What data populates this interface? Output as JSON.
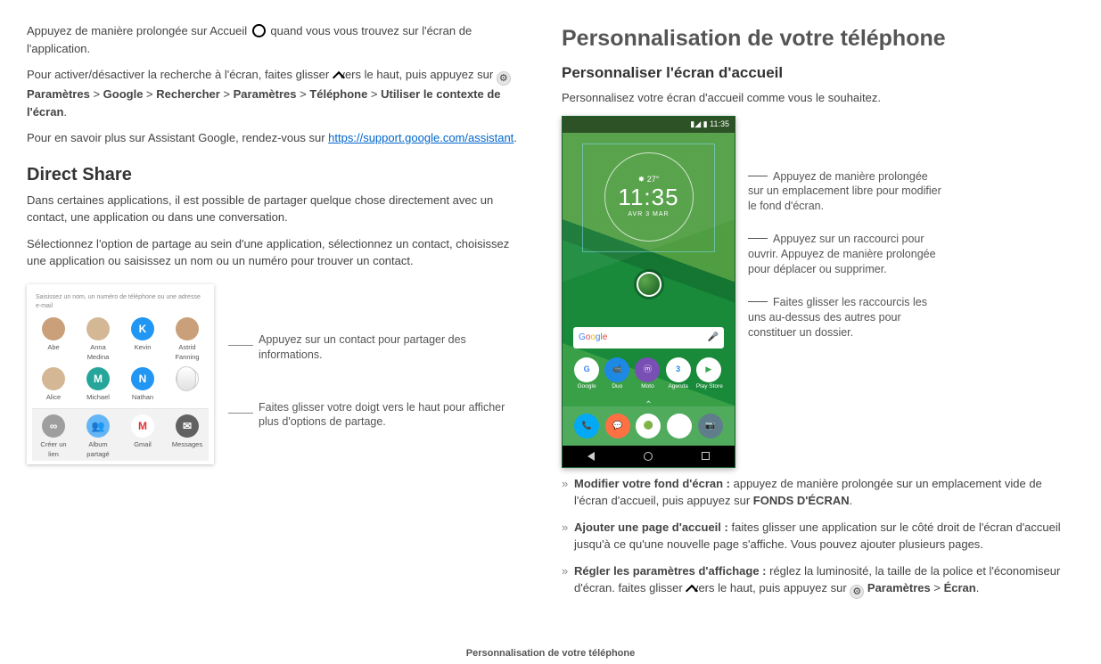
{
  "left": {
    "para1_prefix": "Appuyez de manière prolongée sur Accueil ",
    "para1_suffix": " quand vous vous trouvez sur l'écran de l'application.",
    "para2_prefix": "Pour activer/désactiver la recherche à l'écran, faites glisser ",
    "para2_mid": " vers le haut, puis appuyez sur ",
    "breadcrumb": {
      "settings": "Paramètres",
      "google": "Google",
      "search": "Rechercher",
      "settings2": "Paramètres",
      "phone": "Téléphone",
      "use_context": "Utiliser le contexte de l'écran"
    },
    "para3_prefix": "Pour en savoir plus sur Assistant Google, rendez-vous sur ",
    "assistant_link": "https://support.google.com/assistant",
    "direct_share_heading": "Direct Share",
    "ds_p1": "Dans certaines applications, il est possible de partager quelque chose directement avec un contact, une application ou dans une conversation.",
    "ds_p2": "Sélectionnez l'option de partage au sein d'une application, sélectionnez un contact, choisissez une application ou saisissez un nom ou un numéro pour trouver un contact.",
    "share_panel": {
      "hint": "Saisissez un nom, un numéro de téléphone ou une adresse e-mail",
      "row1": [
        "Abe",
        "Anna Medina",
        "Kevin",
        "Astrid Fanning"
      ],
      "row1_letters": [
        "",
        "",
        "K",
        ""
      ],
      "row2": [
        "Alice",
        "Michael",
        "Nathan",
        ""
      ],
      "row2_letters": [
        "",
        "M",
        "N",
        "•••"
      ],
      "bottom": [
        "Créer un lien",
        "Album partagé",
        "Gmail",
        "Messages"
      ]
    },
    "callout_contact": "Appuyez sur un contact pour partager des informations.",
    "callout_swipe": "Faites glisser votre doigt vers le haut pour afficher plus d'options de partage."
  },
  "right": {
    "h1": "Personnalisation de votre téléphone",
    "h3": "Personnaliser l'écran d'accueil",
    "intro": "Personnalisez votre écran d'accueil comme vous le souhaitez.",
    "phone": {
      "status_time": "11:35",
      "clock_temp": "✸ 27°",
      "clock_time": "11:35",
      "clock_date": "AVR 3 MAR",
      "apps": [
        "Google",
        "Duo",
        "Moto",
        "Agenda",
        "Play Store"
      ]
    },
    "callouts": {
      "c1": "Appuyez de manière prolongée sur un emplacement libre pour modifier le fond d'écran.",
      "c2": "Appuyez sur un raccourci pour ouvrir. Appuyez de manière prolongée pour déplacer ou supprimer.",
      "c3": "Faites glisser les raccourcis les uns au-dessus des autres pour constituer un dossier."
    },
    "tips": {
      "t1_bold": "Modifier votre fond d'écran :",
      "t1_rest": " appuyez de manière prolongée sur un emplacement vide de l'écran d'accueil, puis appuyez sur ",
      "t1_caps": "FONDS D'ÉCRAN",
      "t2_bold": "Ajouter une page d'accueil :",
      "t2_rest": " faites glisser une application sur le côté droit de l'écran d'accueil jusqu'à ce qu'une nouvelle page s'affiche. Vous pouvez ajouter plusieurs pages.",
      "t3_bold": "Régler les paramètres d'affichage :",
      "t3_rest_a": " réglez la luminosité, la taille de la police et l'économiseur d'écran. faites glisser ",
      "t3_rest_b": " vers le haut, puis appuyez sur ",
      "t3_settings": "Paramètres",
      "t3_screen": "Écran"
    }
  },
  "footer": "Personnalisation de votre téléphone",
  "sep": " > ",
  "period": "."
}
